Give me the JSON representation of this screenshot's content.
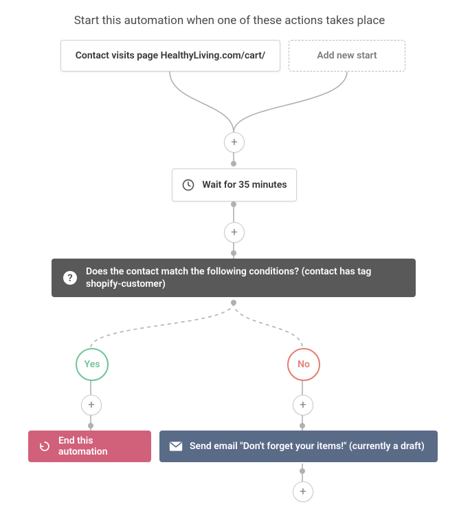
{
  "title": "Start this automation when one of these actions takes place",
  "start": {
    "contact_label": "Contact visits page HealthyLiving.com/cart/",
    "add_label": "Add new start"
  },
  "wait": {
    "label": "Wait for 35 minutes"
  },
  "condition": {
    "text": "Does the contact match the following conditions? (contact has tag shopify-customer)"
  },
  "branches": {
    "yes": "Yes",
    "no": "No"
  },
  "actions": {
    "end_label": "End this automation",
    "send_label": "Send email \"Don't forget your items!\" (currently a draft)"
  },
  "icons": {
    "plus": "+"
  }
}
